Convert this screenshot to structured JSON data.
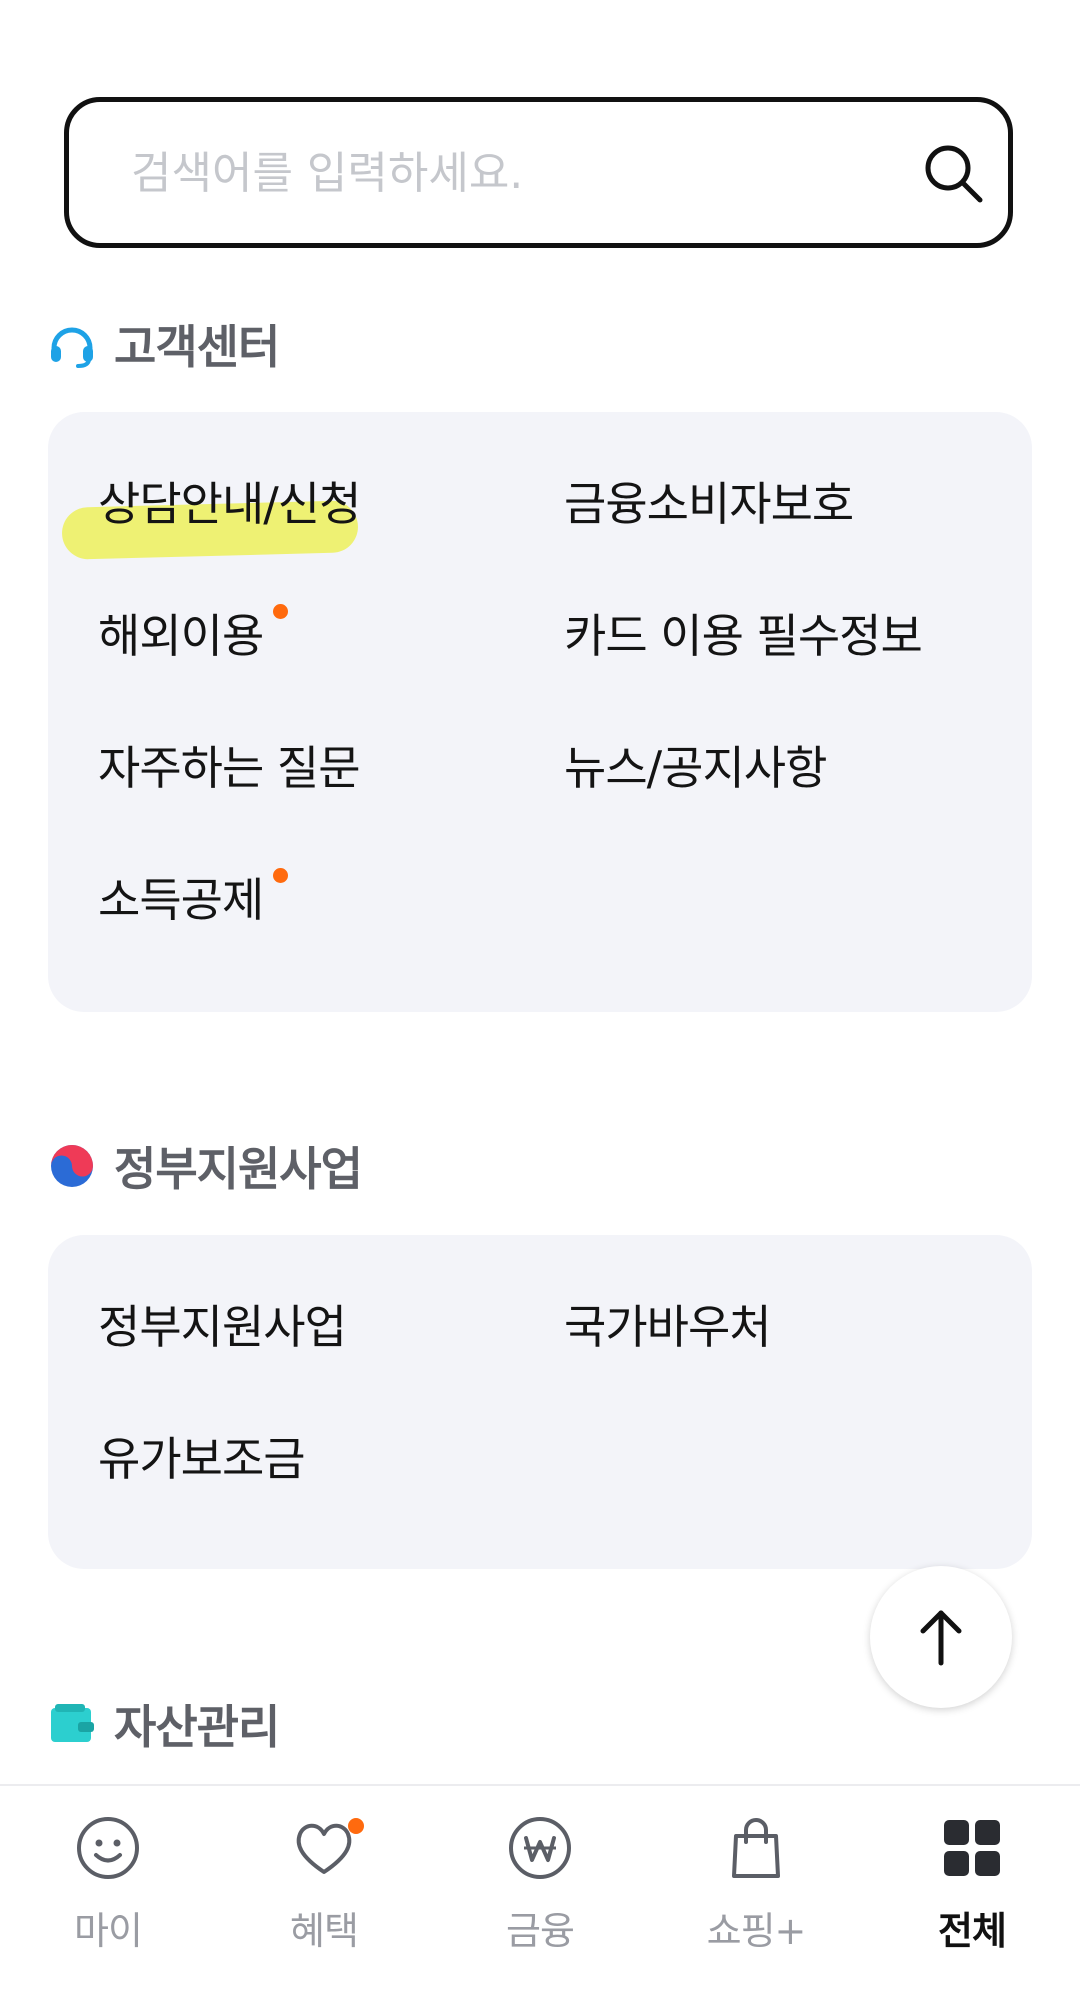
{
  "search": {
    "placeholder": "검색어를 입력하세요."
  },
  "sections": {
    "customer": {
      "title": "고객센터",
      "items": [
        {
          "label": "상담안내/신청",
          "dot": false
        },
        {
          "label": "금융소비자보호",
          "dot": false
        },
        {
          "label": "해외이용",
          "dot": true
        },
        {
          "label": "카드 이용 필수정보",
          "dot": false
        },
        {
          "label": "자주하는 질문",
          "dot": false
        },
        {
          "label": "뉴스/공지사항",
          "dot": false
        },
        {
          "label": "소득공제",
          "dot": true
        }
      ]
    },
    "government": {
      "title": "정부지원사업",
      "items": [
        {
          "label": "정부지원사업"
        },
        {
          "label": "국가바우처"
        },
        {
          "label": "유가보조금"
        }
      ]
    },
    "asset": {
      "title": "자산관리"
    }
  },
  "bottom_nav": {
    "items": [
      {
        "label": "마이",
        "icon": "smile-icon"
      },
      {
        "label": "혜택",
        "icon": "heart-icon"
      },
      {
        "label": "금융",
        "icon": "won-icon"
      },
      {
        "label": "쇼핑+",
        "icon": "shopping-bag-icon"
      },
      {
        "label": "전체",
        "icon": "grid-icon"
      }
    ],
    "active_index": 4
  },
  "colors": {
    "accent_dot": "#ff6a0e",
    "card_bg": "#f3f4f9",
    "headset_icon": "#1ea2e6",
    "wallet_icon": "#2ccfcf"
  }
}
